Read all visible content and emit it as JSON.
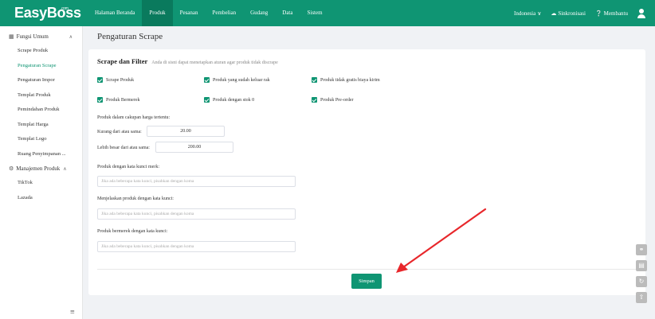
{
  "app": {
    "logo": "EasyBoss",
    "logo_suffix": ".com"
  },
  "nav": {
    "items": [
      {
        "label": "Halaman Beranda"
      },
      {
        "label": "Produk"
      },
      {
        "label": "Pesanan"
      },
      {
        "label": "Pembelian"
      },
      {
        "label": "Gudang"
      },
      {
        "label": "Data"
      },
      {
        "label": "Sistem"
      }
    ],
    "active": "Produk",
    "language": "Indonesia",
    "sync": "Sinkronisasi",
    "help": "Membantu"
  },
  "sidebar": {
    "groups": [
      {
        "label": "Fungsi Umum",
        "items": [
          {
            "label": "Scrape Produk"
          },
          {
            "label": "Pengaturan Scrape"
          },
          {
            "label": "Pengaturan Impor"
          },
          {
            "label": "Templat Produk"
          },
          {
            "label": "Pemindahan Produk"
          },
          {
            "label": "Templat Harga"
          },
          {
            "label": "Templat Logo"
          },
          {
            "label": "Ruang Penyimpanan ..."
          }
        ]
      },
      {
        "label": "Manajemen Produk",
        "items": [
          {
            "label": "TikTok"
          },
          {
            "label": "Lazada"
          }
        ]
      }
    ],
    "active_item": "Pengaturan Scrape"
  },
  "page": {
    "title": "Pengaturan Scrape"
  },
  "form": {
    "section_title": "Scrape dan Filter",
    "section_desc": "Anda di sisni dapat menetapkan aturan agar produk tidak discrape",
    "checkboxes": [
      {
        "label": "Scrape Produk",
        "checked": true
      },
      {
        "label": "Produk yang sudah keluar rak",
        "checked": true
      },
      {
        "label": "Produk tidak gratis biaya kirim",
        "checked": true
      },
      {
        "label": "Produk Bermerek",
        "checked": true
      },
      {
        "label": "Produk dengan stok 0",
        "checked": true
      },
      {
        "label": "Produk Pre-order",
        "checked": true
      }
    ],
    "price_range_label": "Produk dalam cakupan harga tertentu:",
    "less_equal_label": "Kurang dari atau sama:",
    "less_equal_value": "20.00",
    "greater_equal_label": "Lebih besar dari atau sama:",
    "greater_equal_value": "200.00",
    "brand_keywords_label": "Produk dengan kata kunci merk:",
    "explain_keywords_label": "Menjelaskan produk dengan kata kunci:",
    "brand_named_keywords_label": "Produk bermerek dengan kata kunci:",
    "keyword_placeholder": "Jika ada beberapa kata kunci, pisahkan dengan koma",
    "save_label": "Simpan"
  },
  "colors": {
    "brand": "#0f9573",
    "annotation": "#e8272b"
  }
}
